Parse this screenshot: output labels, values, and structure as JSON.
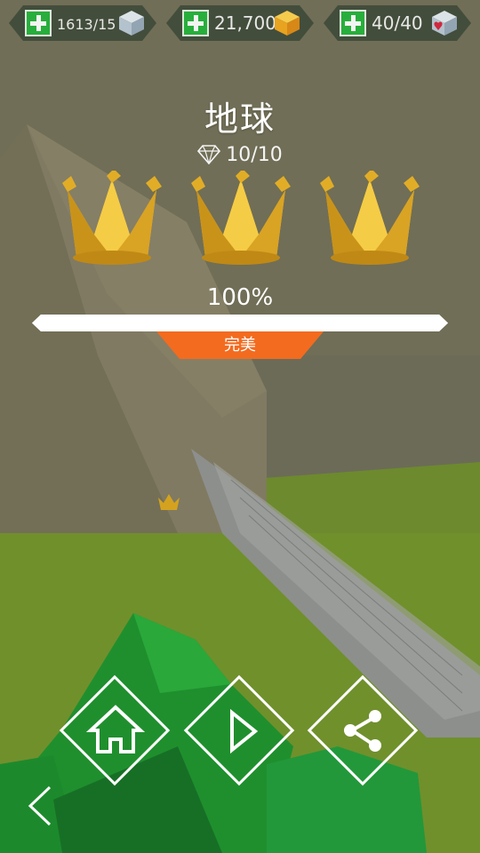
{
  "currencies": [
    {
      "name": "cubes",
      "value": "1613/15",
      "icon": "ice-cube-icon"
    },
    {
      "name": "gold",
      "value": "21,700",
      "icon": "gold-cube-icon"
    },
    {
      "name": "lives",
      "value": "40/40",
      "icon": "heart-cube-icon"
    }
  ],
  "level": {
    "title": "地球",
    "gems": "10/10",
    "gem_icon": "diamond-icon",
    "crowns_earned": 3,
    "crowns_total": 3,
    "progress_label": "100%",
    "progress_value": 1.0,
    "rating": "完美"
  },
  "buttons": {
    "home_icon": "home-icon",
    "play_icon": "play-icon",
    "share_icon": "share-icon",
    "back_icon": "chevron-left-icon"
  },
  "colors": {
    "accent": "#f36b1f",
    "crown_gold": "#e8b528",
    "plus_green": "#22b43a"
  }
}
